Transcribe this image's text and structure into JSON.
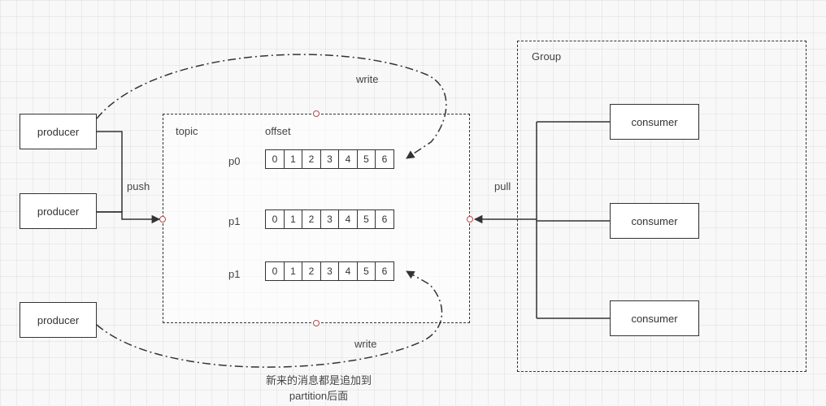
{
  "producers": [
    "producer",
    "producer",
    "producer"
  ],
  "topic": {
    "title": "topic",
    "offset_label": "offset",
    "partitions": [
      {
        "name": "p0",
        "cells": [
          "0",
          "1",
          "2",
          "3",
          "4",
          "5",
          "6"
        ]
      },
      {
        "name": "p1",
        "cells": [
          "0",
          "1",
          "2",
          "3",
          "4",
          "5",
          "6"
        ]
      },
      {
        "name": "p1",
        "cells": [
          "0",
          "1",
          "2",
          "3",
          "4",
          "5",
          "6"
        ]
      }
    ]
  },
  "group": {
    "title": "Group",
    "consumers": [
      "consumer",
      "consumer",
      "consumer"
    ]
  },
  "edge_labels": {
    "push": "push",
    "pull": "pull",
    "write_top": "write",
    "write_bottom": "write"
  },
  "caption_line1": "新来的消息都是追加到",
  "caption_line2": "partition后面"
}
